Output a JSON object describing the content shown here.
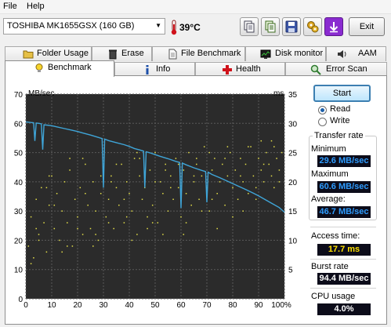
{
  "menu": {
    "file": "File",
    "help": "Help"
  },
  "toolbar": {
    "drive": "TOSHIBA MK1655GSX (160 GB)",
    "temperature": "39°C",
    "buttons": [
      "copy-icon",
      "copy-text-icon",
      "save-icon",
      "options-icon",
      "download-icon"
    ],
    "exit_label": "Exit"
  },
  "tabs": {
    "row1": [
      "Folder Usage",
      "Erase",
      "File Benchmark",
      "Disk monitor",
      "AAM"
    ],
    "row2": [
      "Benchmark",
      "Info",
      "Health",
      "Error Scan"
    ],
    "active": "Benchmark"
  },
  "controls": {
    "start_label": "Start",
    "read_label": "Read",
    "write_label": "Write",
    "selected_mode": "Read"
  },
  "stats": {
    "transfer_rate_title": "Transfer rate",
    "minimum_label": "Minimum",
    "minimum_value": "29.6 MB/sec",
    "maximum_label": "Maximum",
    "maximum_value": "60.6 MB/sec",
    "average_label": "Average:",
    "average_value": "46.7 MB/sec",
    "access_label": "Access time:",
    "access_value": "17.7 ms",
    "burst_label": "Burst rate",
    "burst_value": "94.4 MB/sec",
    "cpu_label": "CPU usage",
    "cpu_value": "4.0%"
  },
  "colors": {
    "plot_bg": "#2b2b2b",
    "grid": "#5a5a5a",
    "transfer_line": "#3fa5d8",
    "access_points": "#e5e04a",
    "tab_health_icon": "#d0121b",
    "download_button": "#8a2bd0"
  },
  "chart_data": {
    "type": "line",
    "left_axis_label": "MB/sec",
    "right_axis_label": "ms",
    "left_ylim": [
      0,
      70
    ],
    "right_ylim": [
      0,
      35
    ],
    "xlim": [
      0,
      100
    ],
    "left_ticks": [
      "0",
      "10",
      "20",
      "30",
      "40",
      "50",
      "60",
      "70"
    ],
    "right_ticks": [
      "5",
      "10",
      "15",
      "20",
      "25",
      "30",
      "35"
    ],
    "x_ticks": [
      "0",
      "10",
      "20",
      "30",
      "40",
      "50",
      "60",
      "70",
      "80",
      "90",
      "100%"
    ],
    "grid": true,
    "series": [
      {
        "axis": "left",
        "x": [
          0,
          2,
          3,
          3.5,
          4,
          5,
          6,
          6.5,
          7,
          8,
          10,
          12,
          15,
          18,
          20,
          22,
          25,
          28,
          29.5,
          30,
          30.5,
          32,
          35,
          38,
          40,
          42,
          44,
          45.5,
          46,
          46.5,
          48,
          50,
          52,
          55,
          58,
          59.5,
          60,
          60.5,
          62,
          65,
          68,
          69.5,
          70,
          70.5,
          72,
          75,
          78,
          80,
          82,
          85,
          88,
          90,
          92,
          95,
          98,
          100
        ],
        "y": [
          60.5,
          60.3,
          60.2,
          54,
          60.1,
          60,
          59.8,
          51,
          59.5,
          59.4,
          59.2,
          58.8,
          58.2,
          57.6,
          57.2,
          56.7,
          56,
          55.2,
          54.8,
          38,
          54.6,
          54.1,
          53.4,
          52.7,
          52.1,
          51.4,
          50.9,
          50.5,
          38,
          50.3,
          49.9,
          49.3,
          48.7,
          47.9,
          47,
          46.6,
          31,
          46.4,
          45.8,
          44.8,
          43.9,
          43.5,
          33,
          43.3,
          42.5,
          41.4,
          40.2,
          39.4,
          38.6,
          37.4,
          36.1,
          35.2,
          34.2,
          32.7,
          31.2,
          29.6
        ]
      },
      {
        "axis": "right",
        "type": "scatter",
        "description": "access time",
        "x": [
          1,
          2,
          3,
          4,
          5,
          6,
          7,
          8,
          9,
          10,
          11,
          12,
          13,
          14,
          15,
          16,
          17,
          18,
          19,
          20,
          21,
          22,
          23,
          24,
          25,
          26,
          27,
          28,
          29,
          30,
          31,
          32,
          33,
          34,
          35,
          36,
          37,
          38,
          39,
          40,
          41,
          42,
          43,
          44,
          45,
          46,
          47,
          48,
          49,
          50,
          51,
          52,
          53,
          54,
          55,
          56,
          57,
          58,
          59,
          60,
          61,
          62,
          63,
          64,
          65,
          66,
          67,
          68,
          69,
          70,
          71,
          72,
          73,
          74,
          75,
          76,
          77,
          78,
          79,
          80,
          81,
          82,
          83,
          84,
          85,
          86,
          87,
          88,
          89,
          90,
          91,
          92,
          93,
          94,
          95,
          96,
          97,
          98,
          99,
          2,
          5,
          8,
          11,
          14,
          17,
          20,
          23,
          26,
          29,
          32,
          35,
          38,
          41,
          44,
          47,
          50,
          53,
          56,
          59,
          62,
          65,
          68,
          71,
          74,
          77,
          80,
          83,
          86,
          89,
          92,
          95,
          98,
          4,
          9,
          16,
          22,
          27,
          33,
          39,
          43,
          49,
          54,
          61,
          66,
          72,
          78,
          84,
          91,
          96
        ],
        "y": [
          9,
          14,
          7,
          17,
          11,
          19,
          13,
          8,
          16,
          21,
          12,
          18,
          10,
          15,
          20,
          13,
          22,
          9,
          17,
          14,
          19,
          11,
          23,
          16,
          12,
          20,
          15,
          10,
          18,
          22,
          14,
          17,
          21,
          12,
          19,
          16,
          23,
          13,
          20,
          18,
          15,
          24,
          11,
          21,
          17,
          19,
          14,
          22,
          16,
          25,
          13,
          20,
          18,
          23,
          15,
          21,
          17,
          24,
          19,
          14,
          22,
          18,
          25,
          16,
          20,
          23,
          17,
          21,
          26,
          19,
          15,
          22,
          24,
          18,
          20,
          23,
          16,
          21,
          25,
          19,
          22,
          17,
          24,
          20,
          23,
          18,
          26,
          21,
          19,
          24,
          22,
          20,
          25,
          23,
          21,
          26,
          24,
          22,
          25,
          6,
          10,
          19,
          16,
          8,
          24,
          12,
          18,
          9,
          21,
          13,
          23,
          17,
          10,
          24,
          12,
          20,
          11,
          19,
          23,
          13,
          21,
          15,
          25,
          12,
          24,
          14,
          21,
          26,
          17,
          23,
          27,
          20,
          12,
          21,
          9,
          24,
          11,
          20,
          14,
          25,
          13,
          22,
          11,
          24,
          17,
          26,
          15,
          27,
          19
        ]
      }
    ]
  }
}
